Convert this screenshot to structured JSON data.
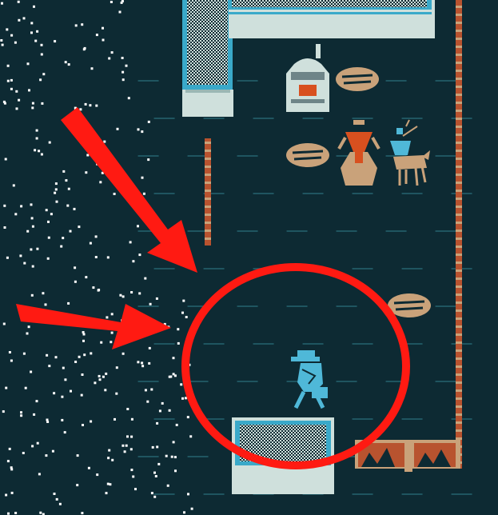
{
  "game": {
    "view": "town-map",
    "palette": {
      "background": "#0d2a33",
      "snow": "#ffffff",
      "stone": "#cfe0dc",
      "stone_dark": "#0f2b33",
      "trim": "#3aa9c9",
      "fence": "#b8532f",
      "fence_light": "#c9a27a",
      "tan": "#c9a27a",
      "orange": "#d8501f",
      "player": "#4fb8d8",
      "overlay_red": "#ff1a12"
    },
    "tiles": {
      "snow_field": "snow-field",
      "buildings": [
        "building-top",
        "building-bottom"
      ],
      "fence_posts": [
        "fence-left",
        "fence-right",
        "fence-bottom"
      ]
    },
    "entities": [
      {
        "name": "furnace-icon",
        "kind": "furnace"
      },
      {
        "name": "bread-icon",
        "kind": "bread"
      },
      {
        "name": "bread-icon",
        "kind": "bread"
      },
      {
        "name": "bread-icon",
        "kind": "bread"
      },
      {
        "name": "urn-icon",
        "kind": "urn"
      },
      {
        "name": "deer-rider-icon",
        "kind": "creature"
      },
      {
        "name": "player-icon",
        "kind": "player"
      }
    ],
    "annotations": [
      {
        "name": "arrow-upper",
        "kind": "arrow"
      },
      {
        "name": "arrow-lower",
        "kind": "arrow"
      },
      {
        "name": "highlight-circle",
        "kind": "circle"
      }
    ]
  }
}
